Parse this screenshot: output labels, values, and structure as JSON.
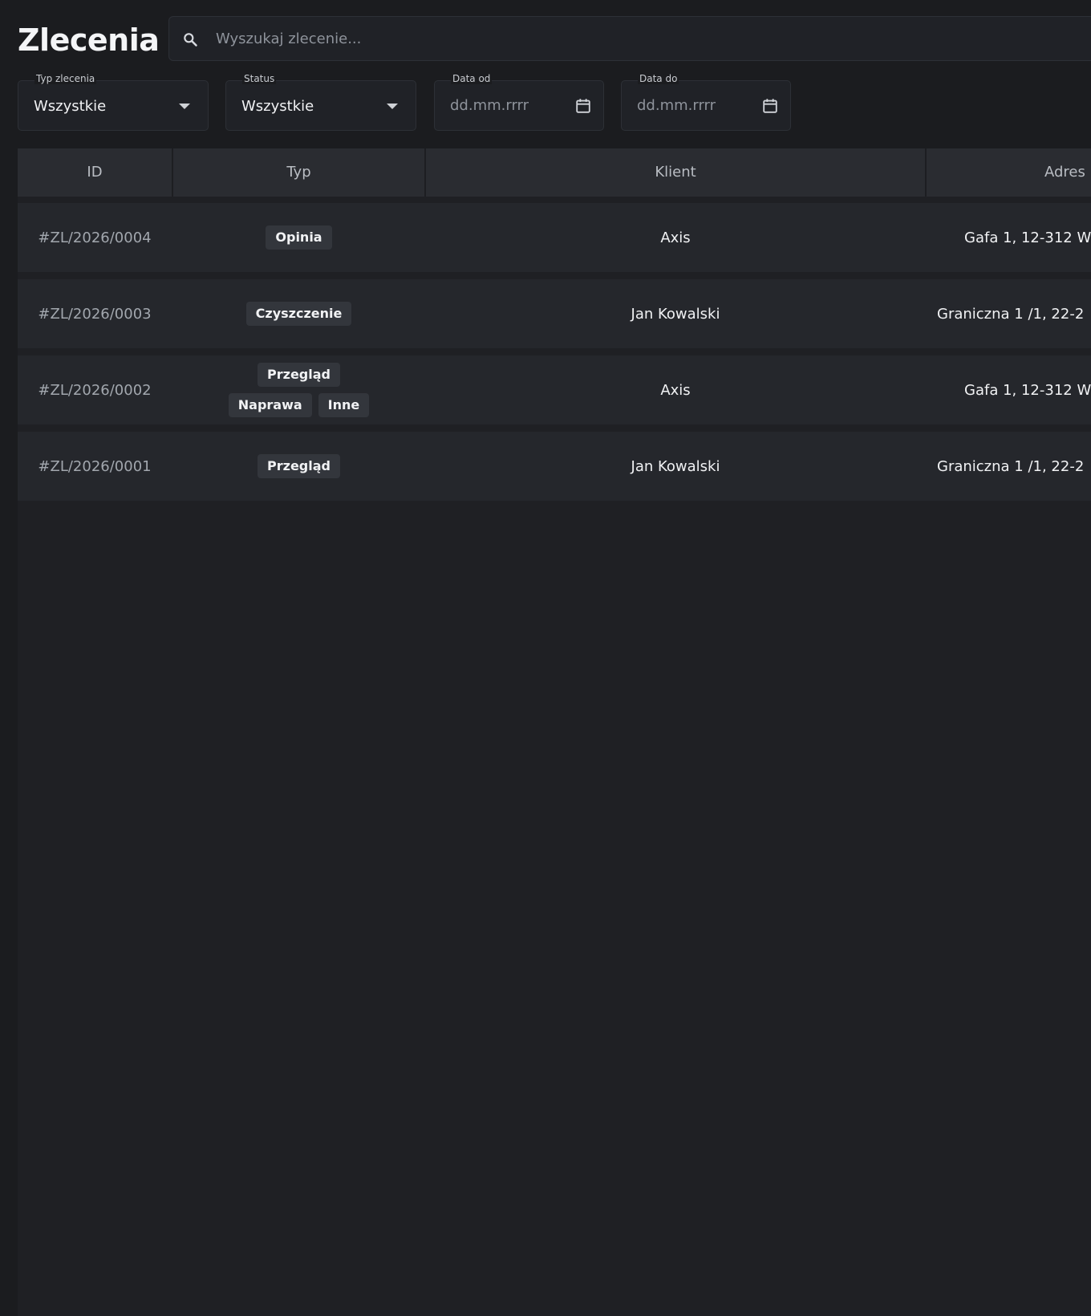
{
  "page": {
    "title": "Zlecenia"
  },
  "search": {
    "placeholder": "Wyszukaj zlecenie...",
    "icon": "search-icon"
  },
  "filters": {
    "order_type": {
      "label": "Typ zlecenia",
      "value": "Wszystkie"
    },
    "status": {
      "label": "Status",
      "value": "Wszystkie"
    },
    "date_from": {
      "label": "Data od",
      "placeholder": "dd.mm.rrrr"
    },
    "date_to": {
      "label": "Data do",
      "placeholder": "dd.mm.rrrr"
    }
  },
  "table": {
    "columns": [
      "ID",
      "Typ",
      "Klient",
      "Adres"
    ],
    "rows": [
      {
        "id": "#ZL/2026/0004",
        "types": [
          "Opinia"
        ],
        "client": "Axis",
        "address": "Gafa 1, 12-312 W"
      },
      {
        "id": "#ZL/2026/0003",
        "types": [
          "Czyszczenie"
        ],
        "client": "Jan Kowalski",
        "address": "Graniczna 1 /1, 22-2"
      },
      {
        "id": "#ZL/2026/0002",
        "types": [
          "Przegląd",
          "Naprawa",
          "Inne"
        ],
        "client": "Axis",
        "address": "Gafa 1, 12-312 W"
      },
      {
        "id": "#ZL/2026/0001",
        "types": [
          "Przegląd"
        ],
        "client": "Jan Kowalski",
        "address": "Graniczna 1 /1, 22-2"
      }
    ]
  },
  "colors": {
    "background": "#1b1c1f",
    "table_header": "#2a2c31",
    "row": "#25272c",
    "tag": "#33363c"
  }
}
